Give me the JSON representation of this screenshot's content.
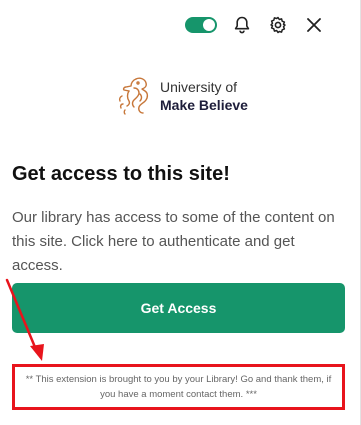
{
  "colors": {
    "accent": "#16956b",
    "annotation": "#e8141c"
  },
  "header": {
    "toggle_state": "on",
    "icons": [
      "toggle-switch",
      "bell-icon",
      "gear-icon",
      "close-icon"
    ]
  },
  "logo": {
    "line1": "University of",
    "line2": "Make Believe"
  },
  "main": {
    "title": "Get access to this site!",
    "description": "Our library has access to some of the content on this site. Click here to authenticate and get access.",
    "button_label": "Get Access"
  },
  "footer": {
    "notice": "** This extension is brought to you by your Library! Go and thank them, if you have a moment contact them. ***"
  }
}
